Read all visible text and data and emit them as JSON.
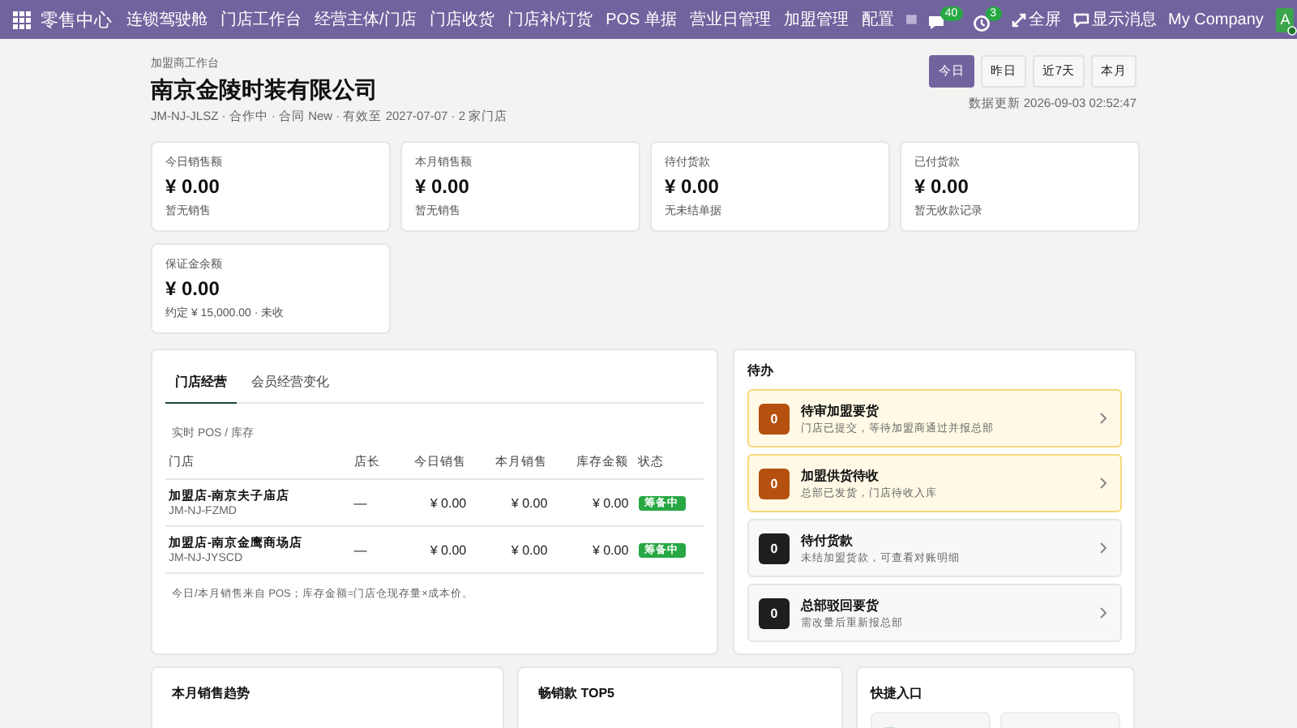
{
  "topbar": {
    "app_title": "零售中心",
    "menu": [
      "连锁驾驶舱",
      "门店工作台",
      "经营主体/门店",
      "门店收货",
      "门店补/订货",
      "POS 单据",
      "营业日管理",
      "加盟管理",
      "配置"
    ],
    "messages_count": "40",
    "activities_count": "3",
    "fullscreen": "全屏",
    "show_messages": "显示消息",
    "company": "My Company",
    "avatar": "A"
  },
  "header": {
    "breadcrumb": "加盟商工作台",
    "title": "南京金陵时装有限公司",
    "meta": "JM-NJ-JLSZ · 合作中 · 合同 New · 有效至 2027-07-07 · 2 家门店",
    "updated": "数据更新 2026-09-03 02:52:47",
    "periods": [
      {
        "label": "今日",
        "selected": true
      },
      {
        "label": "昨日",
        "selected": false
      },
      {
        "label": "近7天",
        "selected": false
      },
      {
        "label": "本月",
        "selected": false
      }
    ]
  },
  "kpis": [
    {
      "label": "今日销售额",
      "value": "¥ 0.00",
      "note": "暂无销售"
    },
    {
      "label": "本月销售额",
      "value": "¥ 0.00",
      "note": "暂无销售"
    },
    {
      "label": "待付货款",
      "value": "¥ 0.00",
      "note": "无未结单据"
    },
    {
      "label": "已付货款",
      "value": "¥ 0.00",
      "note": "暂无收款记录"
    },
    {
      "label": "保证金余额",
      "value": "¥ 0.00",
      "note": "约定 ¥ 15,000.00 · 未收"
    }
  ],
  "store_panel": {
    "tabs": [
      {
        "label": "门店经营",
        "selected": true
      },
      {
        "label": "会员经营变化",
        "selected": false
      }
    ],
    "subtitle": "实时 POS / 库存",
    "columns": [
      "门店",
      "店长",
      "今日销售",
      "本月销售",
      "库存金额",
      "状态"
    ],
    "rows": [
      {
        "name": "加盟店-南京夫子庙店",
        "code": "JM-NJ-FZMD",
        "manager": "—",
        "today": "¥ 0.00",
        "month": "¥ 0.00",
        "stock": "¥ 0.00",
        "status": "筹备中"
      },
      {
        "name": "加盟店-南京金鹰商场店",
        "code": "JM-NJ-JYSCD",
        "manager": "—",
        "today": "¥ 0.00",
        "month": "¥ 0.00",
        "stock": "¥ 0.00",
        "status": "筹备中"
      }
    ],
    "footnote": "今日/本月销售来自 POS；库存金额=门店仓现存量×成本价。"
  },
  "todo": {
    "title": "待办",
    "items": [
      {
        "kind": "warning",
        "count": "0",
        "title": "待审加盟要货",
        "hint": "门店已提交，等待加盟商通过并报总部"
      },
      {
        "kind": "warning",
        "count": "0",
        "title": "加盟供货待收",
        "hint": "总部已发货，门店待收入库"
      },
      {
        "kind": "normal",
        "count": "0",
        "title": "待付货款",
        "hint": "未结加盟货款，可查看对账明细"
      },
      {
        "kind": "normal",
        "count": "0",
        "title": "总部驳回要货",
        "hint": "需改量后重新报总部"
      }
    ]
  },
  "bottom": {
    "trend_title": "本月销售趋势",
    "top5_title": "畅销款 TOP5",
    "shortcuts_title": "快捷入口"
  }
}
